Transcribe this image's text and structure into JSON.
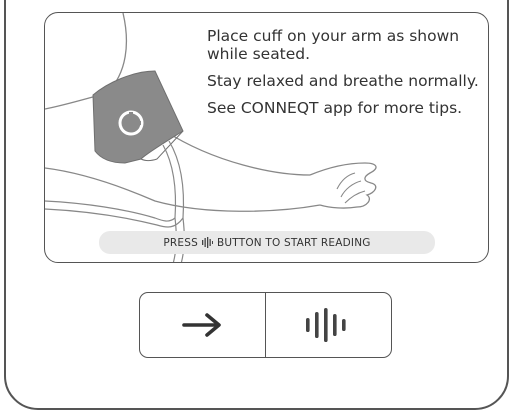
{
  "instructions": {
    "line1": "Place cuff on your arm as shown while seated.",
    "line2": "Stay relaxed and breathe normally.",
    "line3": "See CONNEQT app for more tips."
  },
  "prompt": {
    "before": "PRESS",
    "after": "BUTTON TO START READING",
    "icon": "waveform-icon"
  },
  "buttons": {
    "next": {
      "icon": "arrow-right-icon"
    },
    "start": {
      "icon": "waveform-icon"
    }
  },
  "colors": {
    "outline": "#555555",
    "cuff": "#8a8a8a",
    "prompt_bg": "#e9e9e9",
    "text": "#333333"
  }
}
